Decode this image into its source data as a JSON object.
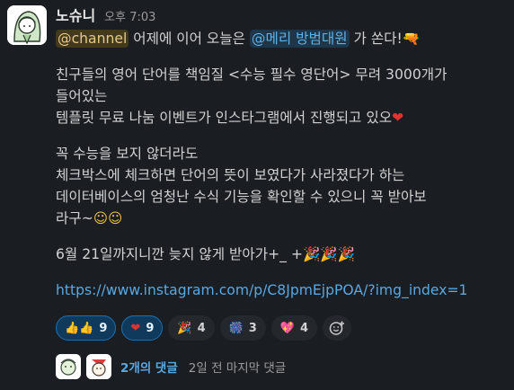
{
  "message": {
    "author": "노슈니",
    "time": "오후 7:03",
    "mention_channel": "@channel",
    "line1_mid": " 어제에 이어 오늘은 ",
    "mention_user": "@메리 방범대원",
    "line1_end": " 가 쏜다!",
    "line1_emoji": "🔫",
    "line2": "친구들의 영어 단어를 책임질 <수능 필수 영단어> 무려 3000개가",
    "line3": "들어있는",
    "line4": "템플릿 무료 나눔 이벤트가 인스타그램에서 진행되고 있오",
    "line4_emoji": "❤",
    "line5": "꼭 수능을 보지 않더라도",
    "line6": "체크박스에 체크하면 단어의 뜻이 보였다가 사라졌다가 하는",
    "line7": "데이터베이스의 엄청난 수식 기능을 확인할 수 있으니 꼭 받아보",
    "line8": "라구~",
    "line8_emoji": "☺☺",
    "line9": "6월 21일까지니깐 늦지 않게 받아가+_ +",
    "line9_emoji": "🎉🎉🎉",
    "link": "https://www.instagram.com/p/C8JpmEjpPOA/?img_index=1"
  },
  "reactions": [
    {
      "emoji": "👍👍",
      "count": "9",
      "active": true
    },
    {
      "emoji": "❤",
      "count": "9",
      "active": true
    },
    {
      "emoji": "🎉",
      "count": "4",
      "active": false
    },
    {
      "emoji": "🎆",
      "count": "3",
      "active": false
    },
    {
      "emoji": "💖",
      "count": "4",
      "active": false
    }
  ],
  "replies": {
    "count_label": "2개의 댓글",
    "last_label": "2일 전 마지막 댓글"
  },
  "colors": {
    "background": "#1a1d21",
    "link": "#5aa8e0",
    "mention_channel_bg": "#423a1b",
    "mention_user_bg": "#1d3649"
  }
}
